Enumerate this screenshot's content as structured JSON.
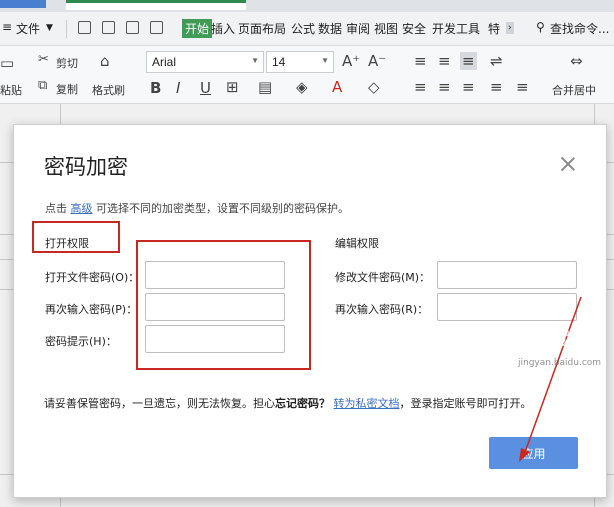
{
  "ribbon": {
    "file_menu": "文件",
    "tabs": [
      "开始",
      "插入",
      "页面布局",
      "公式",
      "数据",
      "审阅",
      "视图",
      "安全",
      "开发工具",
      "特"
    ],
    "search": "查找命令...",
    "cut_label": "剪切",
    "copy_label": "复制",
    "paste_label": "粘贴",
    "format_painter_label": "格式刷",
    "font_name": "Arial",
    "font_size": "14",
    "merge_center_label": "合并居中"
  },
  "dialog": {
    "title": "密码加密",
    "description_prefix": "点击",
    "description_link": "高级",
    "description_suffix": "可选择不同的加密类型，设置不同级别的密码保护。",
    "open_section": {
      "title": "打开权限",
      "fields": [
        {
          "label": "打开文件密码(O)：",
          "value": ""
        },
        {
          "label": "再次输入密码(P)：",
          "value": ""
        },
        {
          "label": "密码提示(H)：",
          "value": ""
        }
      ]
    },
    "edit_section": {
      "title": "编辑权限",
      "fields": [
        {
          "label": "修改文件密码(M)：",
          "value": ""
        },
        {
          "label": "再次输入密码(R)：",
          "value": ""
        }
      ]
    },
    "note_prefix": "请妥善保管密码，一旦遗忘，则无法恢复。担心",
    "note_bold": "忘记密码？",
    "note_link": "转为私密文档",
    "note_suffix": "，登录指定账号即可打开。",
    "ok_button": "应用"
  },
  "watermark": {
    "text": "Baidu 经验",
    "sub": "jingyan.baidu.com"
  },
  "annotation_color": "#c8281f",
  "accent_color": "#5b8fdf"
}
